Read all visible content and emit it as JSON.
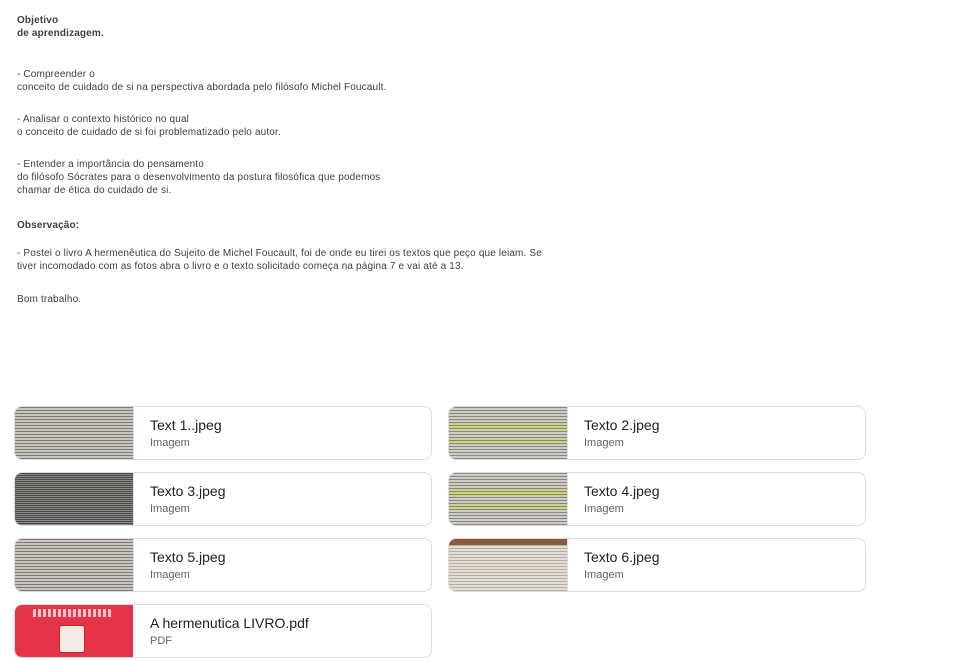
{
  "post": {
    "heading_line1": "Objetivo",
    "heading_line2": "de aprendizagem.",
    "objectives": [
      {
        "line1": "- Compreender o",
        "line2": "conceito de cuidado de si na perspectiva abordada pelo filósofo Michel Foucault."
      },
      {
        "line1": "- Analisar o contexto histórico no qual",
        "line2": "o conceito de cuidado de si foi problematizado pelo autor."
      },
      {
        "line1": "- Entender a importância do pensamento",
        "line2": "do filósofo Sócrates para o desenvolvimento da postura filosófica que podemos",
        "line3": "chamar de ética do cuidado de si."
      }
    ],
    "observation_title": "Observação:",
    "observation_line1": "- Postei o livro A hermenêutica do Sujeito de Michel Foucault, foi de onde eu tirei os textos que peço que leiam. Se",
    "observation_line2": "tiver incomodado com as fotos abra o livro e o texto solicitado começa na página 7 e vai até a 13.",
    "closing": "Bom trabalho."
  },
  "attachments": [
    {
      "title": "Text 1..jpeg",
      "type": "Imagem"
    },
    {
      "title": "Texto 2.jpeg",
      "type": "Imagem"
    },
    {
      "title": "Texto 3.jpeg",
      "type": "Imagem"
    },
    {
      "title": "Texto 4.jpeg",
      "type": "Imagem"
    },
    {
      "title": "Texto 5.jpeg",
      "type": "Imagem"
    },
    {
      "title": "Texto 6.jpeg",
      "type": "Imagem"
    },
    {
      "title": "A hermenutica LIVRO.pdf",
      "type": "PDF"
    }
  ]
}
